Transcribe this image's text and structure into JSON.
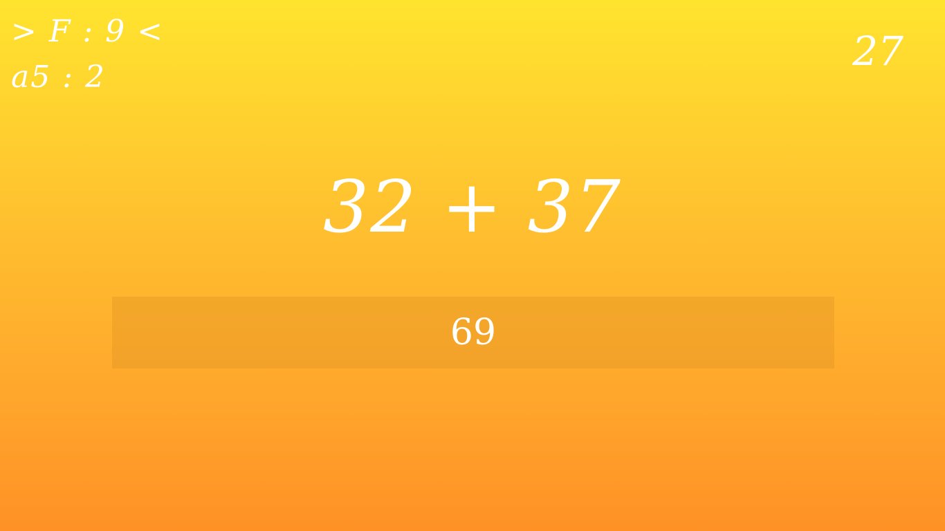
{
  "hud": {
    "line1": "> F : 9 <",
    "line2": "a5 : 2"
  },
  "timer": "27",
  "problem": "32 + 37",
  "answer": "69"
}
